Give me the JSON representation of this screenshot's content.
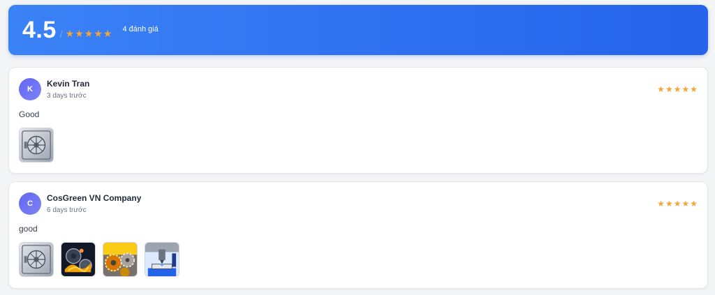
{
  "summary": {
    "average": "4.5",
    "separator": "/",
    "stars": [
      "★",
      "★",
      "★",
      "★",
      "★"
    ],
    "count_label": "4 đánh giá"
  },
  "reviews": [
    {
      "initial": "K",
      "name": "Kevin Tran",
      "date": "3 days trước",
      "stars": [
        "★",
        "★",
        "★",
        "★",
        "★"
      ],
      "content": "Good",
      "images": [
        "vault-door-image"
      ]
    },
    {
      "initial": "C",
      "name": "CosGreen VN Company",
      "date": "6 days trước",
      "stars": [
        "★",
        "★",
        "★",
        "★",
        "★"
      ],
      "content": "good",
      "images": [
        "vault-door-image",
        "molten-gears-image",
        "golden-gears-image",
        "cnc-machine-image"
      ]
    }
  ],
  "colors": {
    "banner_start": "#3b82f6",
    "banner_end": "#2563eb",
    "star": "#f4a534",
    "avatar": "#6366f1"
  }
}
